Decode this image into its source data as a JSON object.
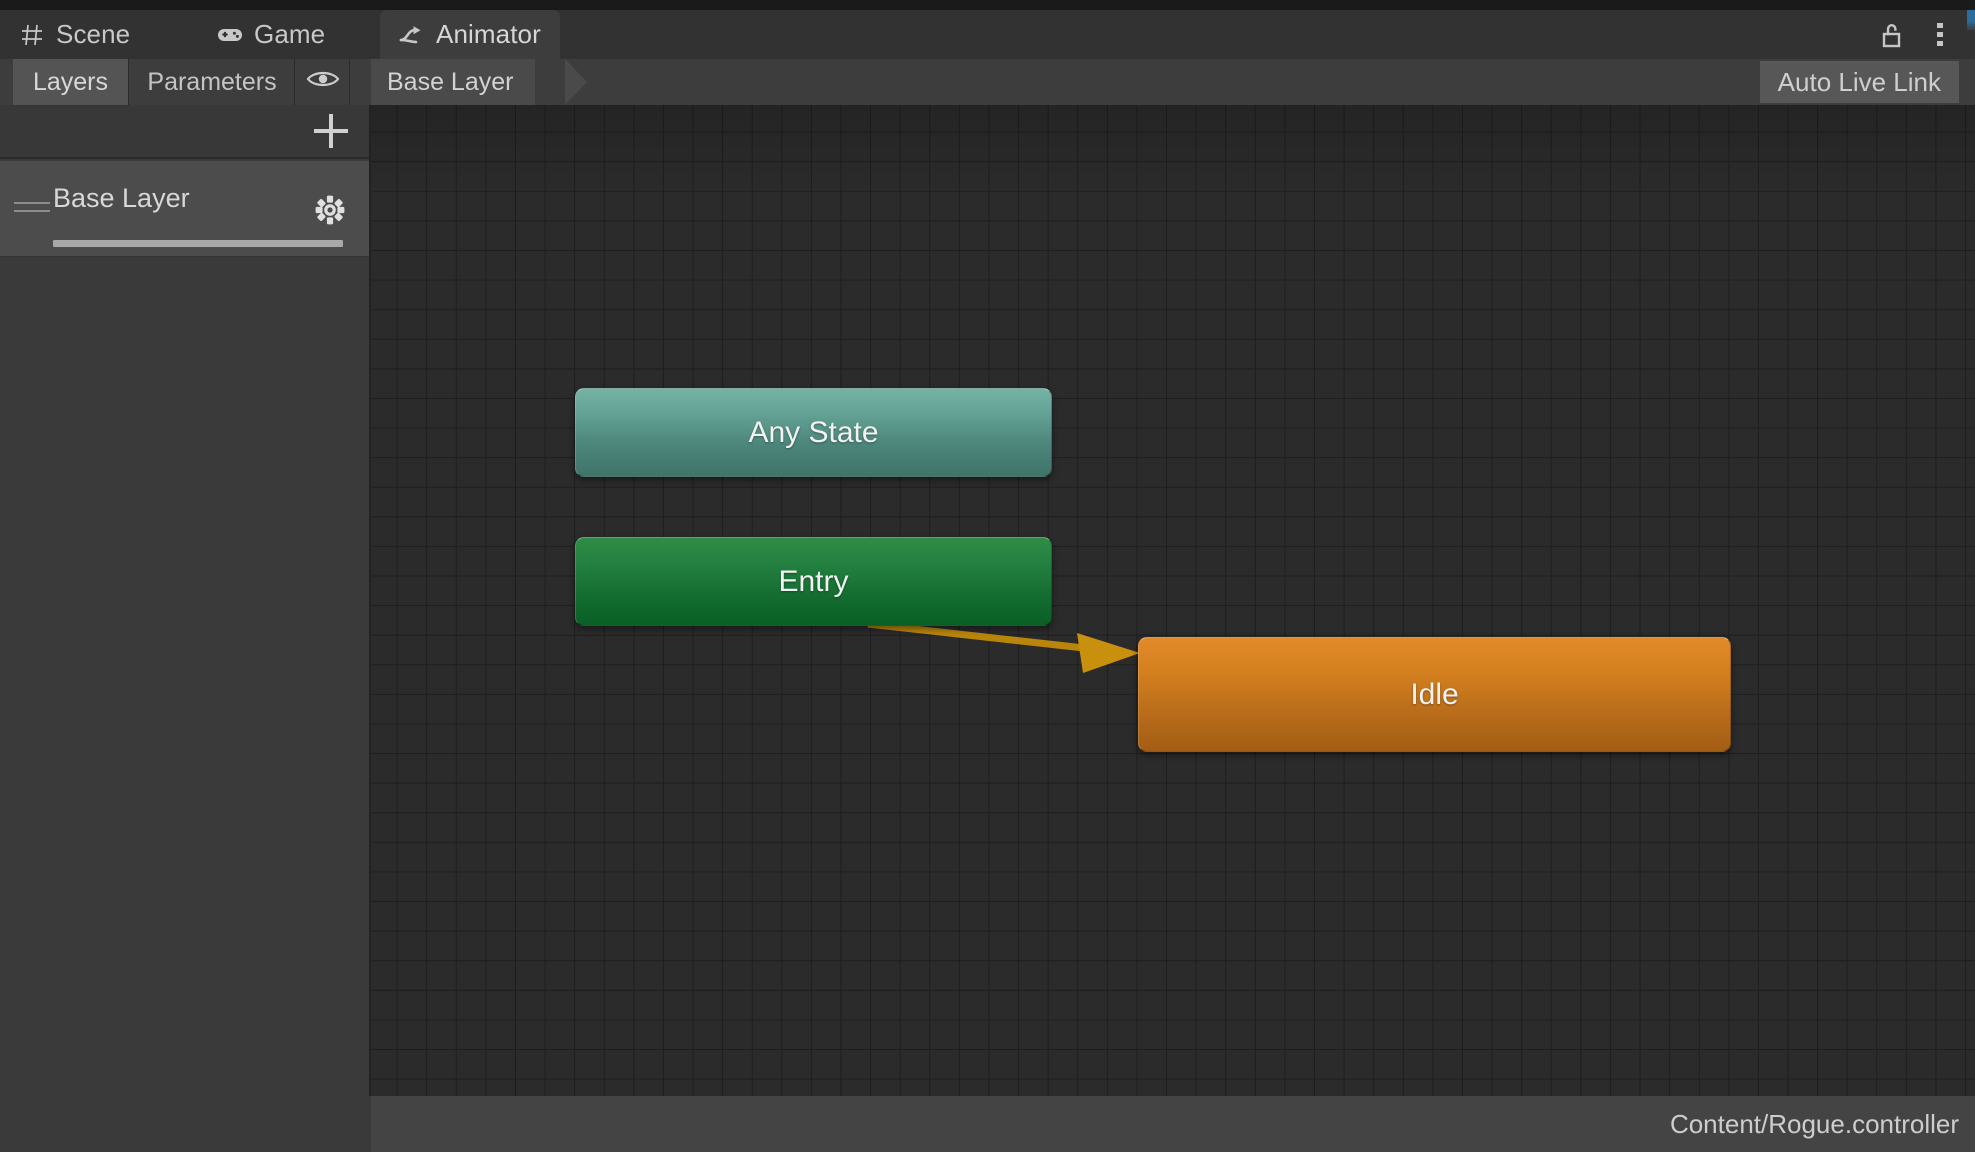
{
  "window": {
    "tabs": [
      {
        "label": "Scene",
        "icon": "grid-icon",
        "active": false
      },
      {
        "label": "Game",
        "icon": "gamepad-icon",
        "active": false
      },
      {
        "label": "Animator",
        "icon": "animator-branch-icon",
        "active": true
      }
    ],
    "controls": [
      {
        "name": "lock-icon",
        "label": "Lock"
      },
      {
        "name": "more-menu-icon",
        "label": "More"
      }
    ]
  },
  "toolbar": {
    "layers_tab": "Layers",
    "parameters_tab": "Parameters",
    "eye_icon": "eye-icon",
    "breadcrumb": "Base Layer",
    "auto_live_link": "Auto Live Link"
  },
  "sidebar": {
    "add_layer_label": "+",
    "layers": [
      {
        "name": "Base Layer",
        "weight": 100,
        "gear_icon": "gear-icon",
        "drag_icon": "drag-handle-icon"
      }
    ]
  },
  "canvas": {
    "nodes": [
      {
        "id": "any-state",
        "label": "Any State",
        "color": "#4b8478"
      },
      {
        "id": "entry",
        "label": "Entry",
        "color": "#11692d"
      },
      {
        "id": "idle",
        "label": "Idle",
        "color": "#b56a19"
      }
    ],
    "transitions": [
      {
        "from": "entry",
        "to": "idle",
        "color": "#b8860b"
      }
    ],
    "grid_size": 29.6,
    "background_color": "#2b2b2b"
  },
  "footer": {
    "asset_path": "Content/Rogue.controller"
  }
}
